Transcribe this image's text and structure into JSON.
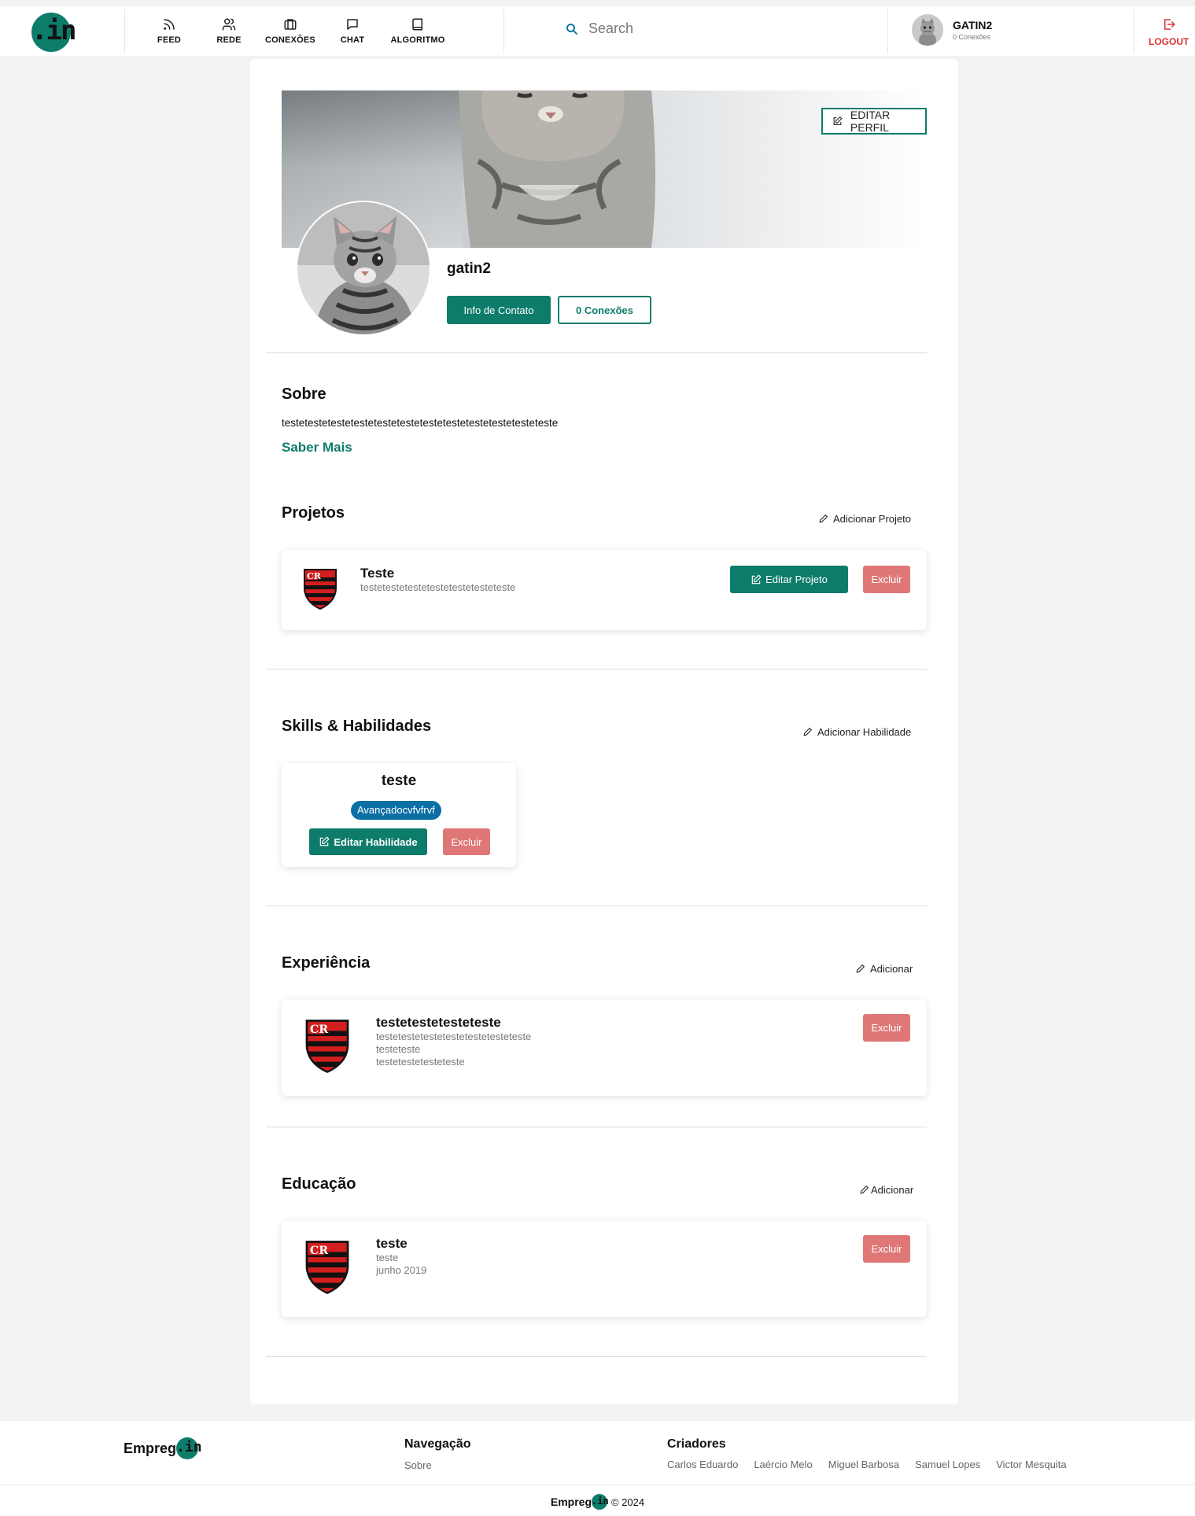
{
  "header": {
    "logo_text": ".in",
    "nav": [
      {
        "label": "FEED",
        "icon": "rss-icon"
      },
      {
        "label": "REDE",
        "icon": "users-icon"
      },
      {
        "label": "CONEXÕES",
        "icon": "briefcase-icon"
      },
      {
        "label": "CHAT",
        "icon": "chat-icon"
      },
      {
        "label": "ALGORITMO",
        "icon": "book-icon"
      }
    ],
    "search_placeholder": "Search",
    "user_name": "GATIN2",
    "user_connections": "0 Conexões",
    "logout_label": "LOGOUT"
  },
  "profile": {
    "edit_profile_label": "EDITAR PERFIL",
    "name": "gatin2",
    "contact_label": "Info de Contato",
    "connections_label": "0 Conexões"
  },
  "about": {
    "title": "Sobre",
    "text": "testetestetestetestetestetestetestetestetestetestetesteteste",
    "more_label": "Saber Mais"
  },
  "projects": {
    "title": "Projetos",
    "add_label": "Adicionar Projeto",
    "items": [
      {
        "title": "Teste",
        "description": "testetestetestetestetestetesteteste",
        "edit_label": "Editar Projeto",
        "delete_label": "Excluir"
      }
    ]
  },
  "skills": {
    "title": "Skills & Habilidades",
    "add_label": "Adicionar Habilidade",
    "items": [
      {
        "name": "teste",
        "level": "Avançadocvfvfrvf",
        "edit_label": "Editar Habilidade",
        "delete_label": "Excluir"
      }
    ]
  },
  "experience": {
    "title": "Experiência",
    "add_label": "Adicionar",
    "items": [
      {
        "title": "testetestetesteteste",
        "line1": "testetestetestetestetestetesteteste",
        "line2": "testeteste",
        "line3": "testetestetesteteste",
        "delete_label": "Excluir"
      }
    ]
  },
  "education": {
    "title": "Educação",
    "add_label": "Adicionar",
    "items": [
      {
        "title": "teste",
        "line1": "teste",
        "line2": "junho 2019",
        "delete_label": "Excluir"
      }
    ]
  },
  "footer": {
    "brand": "Empreg",
    "brand_badge": ".in",
    "nav_title": "Navegação",
    "nav_links": [
      "Sobre"
    ],
    "creators_title": "Criadores",
    "creators": [
      "Carlos Eduardo",
      "Laércio Melo",
      "Miguel Barbosa",
      "Samuel Lopes",
      "Victor Mesquita"
    ],
    "copyright": "© 2024"
  },
  "colors": {
    "accent": "#0e7c6b",
    "danger": "#e07777",
    "badge": "#0b6fa4"
  }
}
